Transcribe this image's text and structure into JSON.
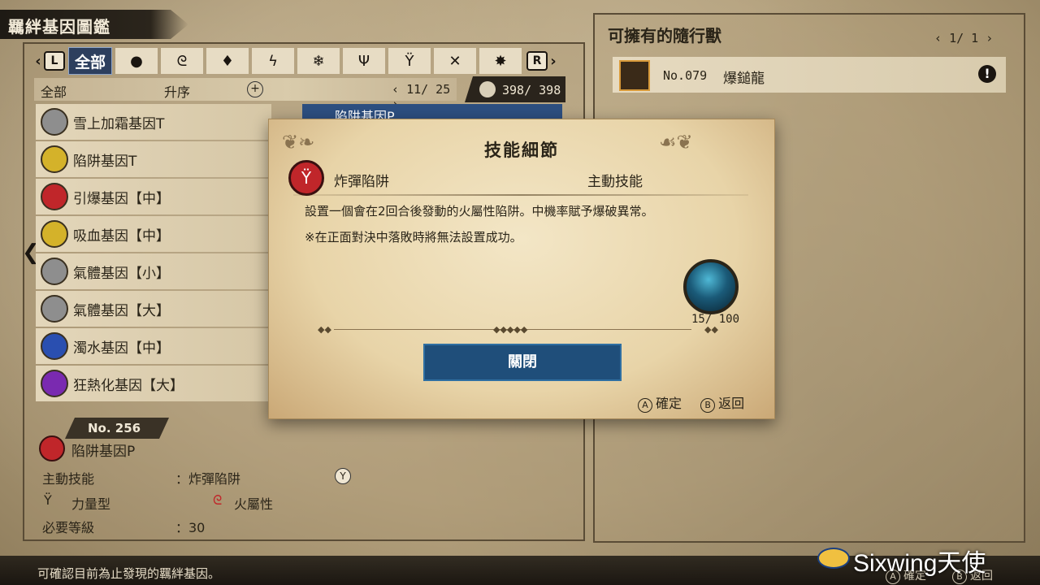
{
  "header": {
    "title": "羈絆基因圖鑑"
  },
  "categories": {
    "left_button": "L",
    "right_button": "R",
    "active_tab": "全部",
    "icons": [
      "ball-icon",
      "flame-swirl-icon",
      "drop-icon",
      "lightning-icon",
      "ice-icon",
      "dragon-icon",
      "power-type-icon",
      "speed-type-icon",
      "technique-type-icon"
    ]
  },
  "sortbar": {
    "filter": "全部",
    "order": "升序",
    "page": "11/ 25"
  },
  "count": "398/ 398",
  "genes": [
    {
      "label": "雪上加霜基因T",
      "color": "#8e8e8e"
    },
    {
      "label": "陷阱基因T",
      "color": "#d4b22a"
    },
    {
      "label": "引爆基因【中】",
      "color": "#c0262a"
    },
    {
      "label": "吸血基因【中】",
      "color": "#d4b22a"
    },
    {
      "label": "氣體基因【小】",
      "color": "#8e8e8e"
    },
    {
      "label": "氣體基因【大】",
      "color": "#8e8e8e"
    },
    {
      "label": "濁水基因【中】",
      "color": "#2a4fb0"
    },
    {
      "label": "狂熱化基因【大】",
      "color": "#7a2ab0"
    }
  ],
  "selected_peek": "陷阱基因P",
  "detail": {
    "no": "No. 256",
    "name": "陷阱基因P",
    "active_skill_label": "主動技能",
    "active_skill_value": "：炸彈陷阱",
    "y_button": "Y",
    "type": "力量型",
    "element": "火屬性",
    "level_label": "必要等級",
    "level_value": "：30"
  },
  "companions": {
    "title": "可擁有的隨行獸",
    "page": "1/ 1",
    "items": [
      {
        "no": "No.079",
        "name": "爆鎚龍"
      }
    ]
  },
  "dialog": {
    "title": "技能細節",
    "skill_name": "炸彈陷阱",
    "skill_type": "主動技能",
    "desc1": "設置一個會在2回合後發動的火屬性陷阱。中機率賦予爆破異常。",
    "desc2": "※在正面對決中落敗時將無法設置成功。",
    "orb_value": "15/ 100",
    "close_label": "關閉",
    "confirm_btn": "A",
    "confirm_label": "確定",
    "back_btn": "B",
    "back_label": "返回"
  },
  "footer": {
    "hint": "可確認目前為止發現的羈絆基因。",
    "confirm_btn": "A",
    "confirm_label": "確定",
    "back_btn": "B",
    "back_label": "返回"
  },
  "watermark": "Sixwing天使"
}
